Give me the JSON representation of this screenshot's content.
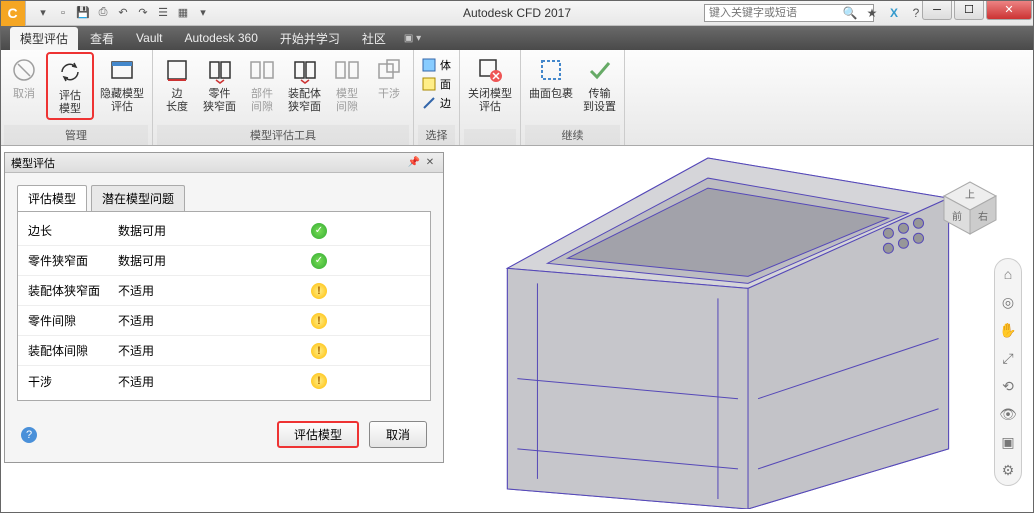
{
  "app": {
    "title": "Autodesk CFD 2017",
    "icon_letter": "C"
  },
  "search": {
    "placeholder": "键入关键字或短语"
  },
  "menubar": {
    "items": [
      "模型评估",
      "查看",
      "Vault",
      "Autodesk 360",
      "开始并学习",
      "社区"
    ],
    "active_index": 0
  },
  "ribbon": {
    "groups": [
      {
        "label": "管理",
        "buttons": [
          {
            "label": "取消",
            "disabled": true
          },
          {
            "label": "评估\n模型",
            "highlight": true
          },
          {
            "label": "隐藏模型\n评估"
          }
        ]
      },
      {
        "label": "模型评估工具",
        "buttons": [
          {
            "label": "边\n长度"
          },
          {
            "label": "零件\n狭窄面"
          },
          {
            "label": "部件\n间隙",
            "disabled": true
          },
          {
            "label": "装配体\n狭窄面"
          },
          {
            "label": "模型\n间隙",
            "disabled": true
          },
          {
            "label": "干涉",
            "disabled": true
          }
        ]
      },
      {
        "label": "选择",
        "small_buttons": [
          "体",
          "面",
          "边"
        ]
      },
      {
        "label": "",
        "buttons": [
          {
            "label": "关闭模型\n评估"
          }
        ]
      },
      {
        "label": "继续",
        "buttons": [
          {
            "label": "曲面包裹"
          },
          {
            "label": "传输\n到设置"
          }
        ]
      }
    ]
  },
  "panel": {
    "title": "模型评估",
    "tabs": [
      "评估模型",
      "潜在模型问题"
    ],
    "active_tab": 0,
    "rows": [
      {
        "name": "边长",
        "value": "数据可用",
        "status": "ok"
      },
      {
        "name": "零件狭窄面",
        "value": "数据可用",
        "status": "ok"
      },
      {
        "name": "装配体狭窄面",
        "value": "不适用",
        "status": "warn"
      },
      {
        "name": "零件间隙",
        "value": "不适用",
        "status": "warn"
      },
      {
        "name": "装配体间隙",
        "value": "不适用",
        "status": "warn"
      },
      {
        "name": "干涉",
        "value": "不适用",
        "status": "warn"
      }
    ],
    "buttons": {
      "primary": "评估模型",
      "secondary": "取消"
    }
  },
  "viewcube": {
    "top": "上",
    "front": "前",
    "right": "右"
  }
}
